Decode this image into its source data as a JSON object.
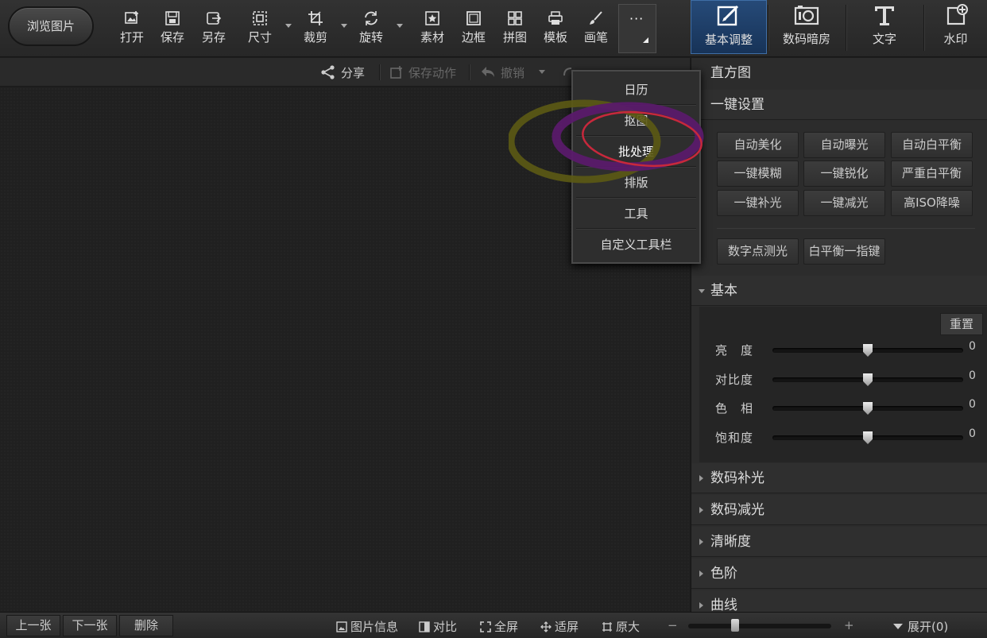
{
  "toolbar": {
    "browse_label": "浏览图片",
    "tools": [
      {
        "label": "打开",
        "icon": "open-image-icon"
      },
      {
        "label": "保存",
        "icon": "save-icon"
      },
      {
        "label": "另存",
        "icon": "save-as-icon"
      },
      {
        "label": "尺寸",
        "icon": "resize-icon"
      },
      {
        "label": "裁剪",
        "icon": "crop-icon"
      },
      {
        "label": "旋转",
        "icon": "rotate-icon"
      },
      {
        "label": "素材",
        "icon": "material-icon"
      },
      {
        "label": "边框",
        "icon": "border-icon"
      },
      {
        "label": "拼图",
        "icon": "collage-icon"
      },
      {
        "label": "模板",
        "icon": "template-icon"
      },
      {
        "label": "画笔",
        "icon": "brush-icon"
      }
    ],
    "more_label": "···"
  },
  "right_tabs": {
    "basic": "基本调整",
    "darkroom": "数码暗房",
    "text": "文字",
    "watermark": "水印"
  },
  "subbar": {
    "share": "分享",
    "save_action": "保存动作",
    "undo": "撤销"
  },
  "menu": {
    "items": [
      "日历",
      "抠图",
      "批处理",
      "排版",
      "工具",
      "自定义工具栏"
    ],
    "active": "批处理"
  },
  "panel": {
    "histogram": "直方图",
    "one_click": "一键设置",
    "quick_buttons": [
      "自动美化",
      "自动曝光",
      "自动白平衡",
      "一键模糊",
      "一键锐化",
      "严重白平衡",
      "一键补光",
      "一键减光",
      "高ISO降噪"
    ],
    "extra_buttons": [
      "数字点测光",
      "白平衡一指键"
    ],
    "basic": "基本",
    "reset": "重置",
    "sliders": [
      {
        "label": "亮　度",
        "value": "0"
      },
      {
        "label": "对比度",
        "value": "0"
      },
      {
        "label": "色　相",
        "value": "0"
      },
      {
        "label": "饱和度",
        "value": "0"
      }
    ],
    "sections": [
      "数码补光",
      "数码减光",
      "清晰度",
      "色阶",
      "曲线"
    ]
  },
  "status": {
    "prev": "上一张",
    "next": "下一张",
    "delete": "删除",
    "info": "图片信息",
    "compare": "对比",
    "fullscreen": "全屏",
    "fit": "适屏",
    "original": "原大",
    "minus": "−",
    "plus": "+",
    "expand": "展开(0)"
  },
  "colors": {
    "accent_tab": "#1f3e66",
    "annotation_yellow": "#5c5a14",
    "annotation_purple": "#5a1a6a",
    "annotation_red": "#c8283c"
  }
}
